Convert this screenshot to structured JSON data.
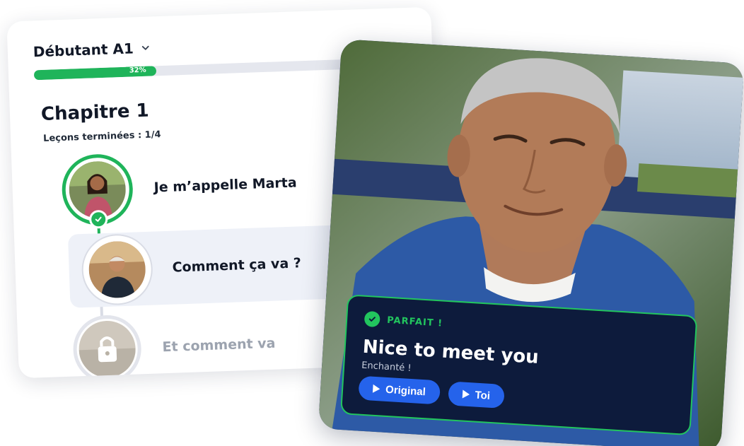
{
  "lesson_card": {
    "level": "Débutant A1",
    "progress": {
      "fraction": 0.32,
      "label": "32%"
    },
    "chapter_title": "Chapitre 1",
    "lessons_done": "Leçons terminées : 1/4",
    "lessons": [
      {
        "label": "Je m’appelle Marta",
        "state": "completed",
        "icon": "check-icon"
      },
      {
        "label": "Comment ça va ?",
        "state": "current",
        "icon": "avatar"
      },
      {
        "label": "Et comment va",
        "state": "locked",
        "icon": "lock-icon"
      }
    ]
  },
  "video_card": {
    "feedback": {
      "status": "PARFAIT !",
      "phrase": "Nice to meet you",
      "translation": "Enchanté !",
      "buttons": {
        "original": "Original",
        "toi": "Toi"
      }
    }
  },
  "colors": {
    "accent_green": "#1fb45a",
    "button_blue": "#2563eb",
    "feedback_bg": "#0d1b3c"
  }
}
